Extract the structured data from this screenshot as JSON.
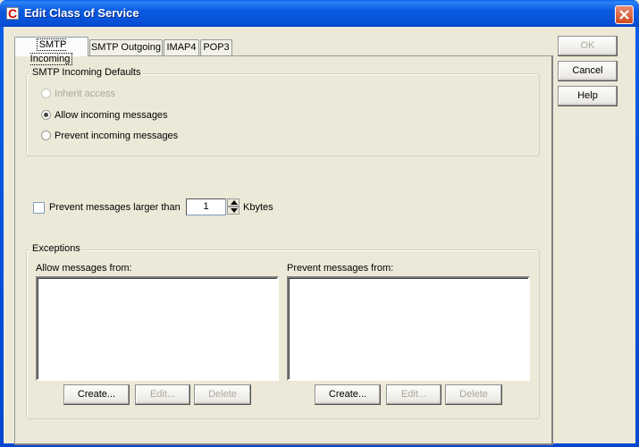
{
  "window": {
    "title": "Edit Class of Service",
    "app_icon_letter": "C",
    "close_icon": "close-x-icon"
  },
  "tabs": [
    {
      "label": "SMTP Incoming",
      "active": true
    },
    {
      "label": "SMTP Outgoing",
      "active": false
    },
    {
      "label": "IMAP4",
      "active": false
    },
    {
      "label": "POP3",
      "active": false
    }
  ],
  "side_buttons": {
    "ok": {
      "label": "OK",
      "enabled": false
    },
    "cancel": {
      "label": "Cancel",
      "enabled": true
    },
    "help": {
      "label": "Help",
      "enabled": true
    }
  },
  "defaults_group": {
    "legend": "SMTP Incoming Defaults",
    "options": [
      {
        "label": "Inherit access",
        "checked": false,
        "enabled": false
      },
      {
        "label": "Allow incoming messages",
        "checked": true,
        "enabled": true
      },
      {
        "label": "Prevent incoming messages",
        "checked": false,
        "enabled": true
      }
    ]
  },
  "size_limit": {
    "checkbox_label": "Prevent messages larger than",
    "checked": false,
    "value": "1",
    "unit_label": "Kbytes"
  },
  "exceptions_group": {
    "legend": "Exceptions",
    "allow": {
      "label": "Allow messages from:",
      "items": [],
      "buttons": {
        "create": "Create...",
        "edit": "Edit...",
        "delete": "Delete"
      }
    },
    "prevent": {
      "label": "Prevent messages from:",
      "items": [],
      "buttons": {
        "create": "Create...",
        "edit": "Edit...",
        "delete": "Delete"
      }
    }
  }
}
